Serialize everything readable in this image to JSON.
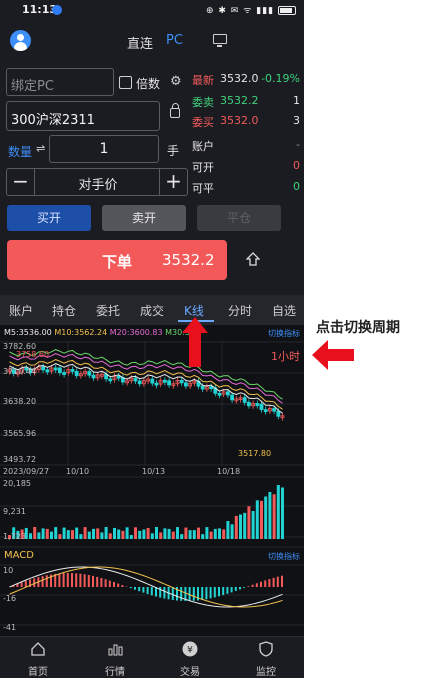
{
  "status_bar": {
    "time": "11:13"
  },
  "header": {
    "direct_label": "直连",
    "pc_label": "PC"
  },
  "form": {
    "account_placeholder": "绑定PC",
    "multiplier_label": "倍数",
    "contract": "300沪深2311",
    "quantity_label": "数量",
    "quantity": "1",
    "unit": "手",
    "price_type": "对手价",
    "minus": "−",
    "plus": "+"
  },
  "quote": {
    "latest_label": "最新",
    "latest_price": "3532.0",
    "latest_change": "-0.19%",
    "ask_label": "委卖",
    "ask_price": "3532.2",
    "ask_qty": "1",
    "bid_label": "委买",
    "bid_price": "3532.0",
    "bid_qty": "3",
    "account_label": "账户",
    "account_value": "-",
    "open_label": "可开",
    "open_value": "0",
    "close_label": "可平",
    "close_value": "0"
  },
  "buttons": {
    "buy_open": "买开",
    "sell_open": "卖开",
    "close": "平仓",
    "order": "下单",
    "order_price": "3532.2"
  },
  "tabs": [
    {
      "label": "账户"
    },
    {
      "label": "持仓"
    },
    {
      "label": "委托"
    },
    {
      "label": "成交"
    },
    {
      "label": "K线"
    },
    {
      "label": "分时"
    },
    {
      "label": "自选"
    }
  ],
  "chart": {
    "ma5": "M5:3536.00",
    "ma10": "M10:3562.24",
    "ma20": "M20:3600.83",
    "ma30": "M30:34",
    "switch_indicator": "切换指标",
    "period": "1小时",
    "y_ticks": [
      "3782.60",
      "3710.44",
      "3638.20",
      "3565.96",
      "3493.72"
    ],
    "high_label": "3758.60",
    "low_label": "3517.80",
    "x_ticks": [
      "2023/09/27",
      "10/10",
      "10/13",
      "10/18"
    ],
    "vol_ticks": [
      "20,185",
      "9,231",
      "1,723"
    ],
    "macd_label": "MACD",
    "macd_ticks": [
      "10",
      "-16",
      "-41"
    ]
  },
  "nav": [
    {
      "label": "首页",
      "icon": "home-icon"
    },
    {
      "label": "行情",
      "icon": "market-icon"
    },
    {
      "label": "交易",
      "icon": "trade-icon"
    },
    {
      "label": "监控",
      "icon": "shield-icon"
    }
  ],
  "annotation": {
    "text": "点击切换周期"
  },
  "colors": {
    "up": "#f25a5a",
    "down": "#22d3d3",
    "accent": "#3e8ef7",
    "arrow": "#e8101c"
  }
}
